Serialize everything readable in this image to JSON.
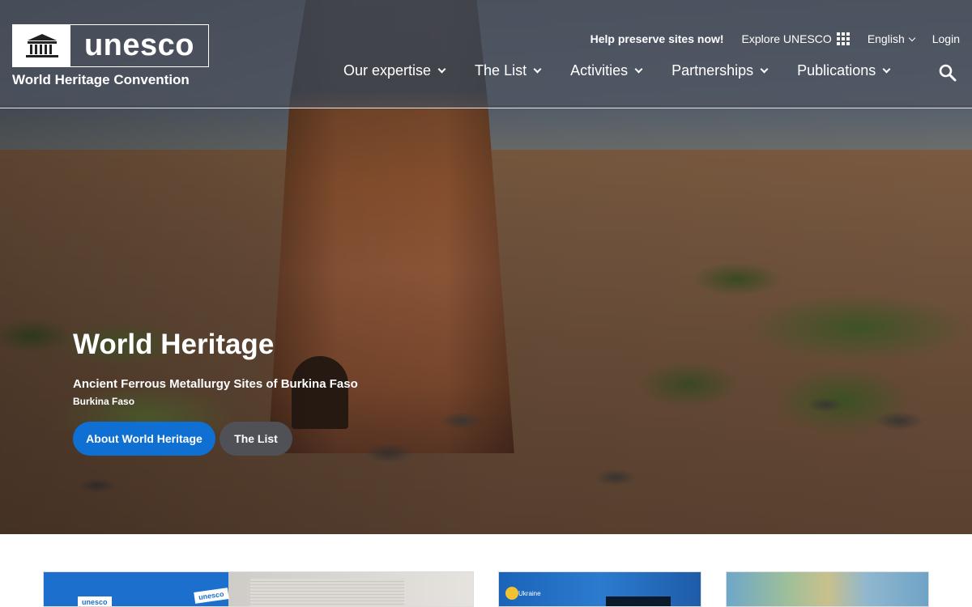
{
  "header": {
    "logo_text": "unesco",
    "logo_subtitle": "World Heritage Convention",
    "utility": {
      "help": "Help preserve sites now!",
      "explore": "Explore UNESCO",
      "language": "English",
      "login": "Login"
    },
    "nav": [
      {
        "label": "Our expertise"
      },
      {
        "label": "The List"
      },
      {
        "label": "Activities"
      },
      {
        "label": "Partnerships"
      },
      {
        "label": "Publications"
      }
    ]
  },
  "hero": {
    "title": "World Heritage",
    "site_name": "Ancient Ferrous Metallurgy Sites of Burkina Faso",
    "country": "Burkina Faso",
    "primary_button": "About World Heritage",
    "secondary_button": "The List"
  },
  "cards": {
    "card1_label_a": "unesco",
    "card1_label_b": "unesco",
    "card2_label": "Ukraine"
  },
  "colors": {
    "primary_button": "#0f6fd2",
    "secondary_button": "#4f5157",
    "header_overlay": "#464e5a"
  },
  "icons": [
    "unesco-temple-icon",
    "grid-dots-icon",
    "chevron-down-icon",
    "search-icon"
  ]
}
